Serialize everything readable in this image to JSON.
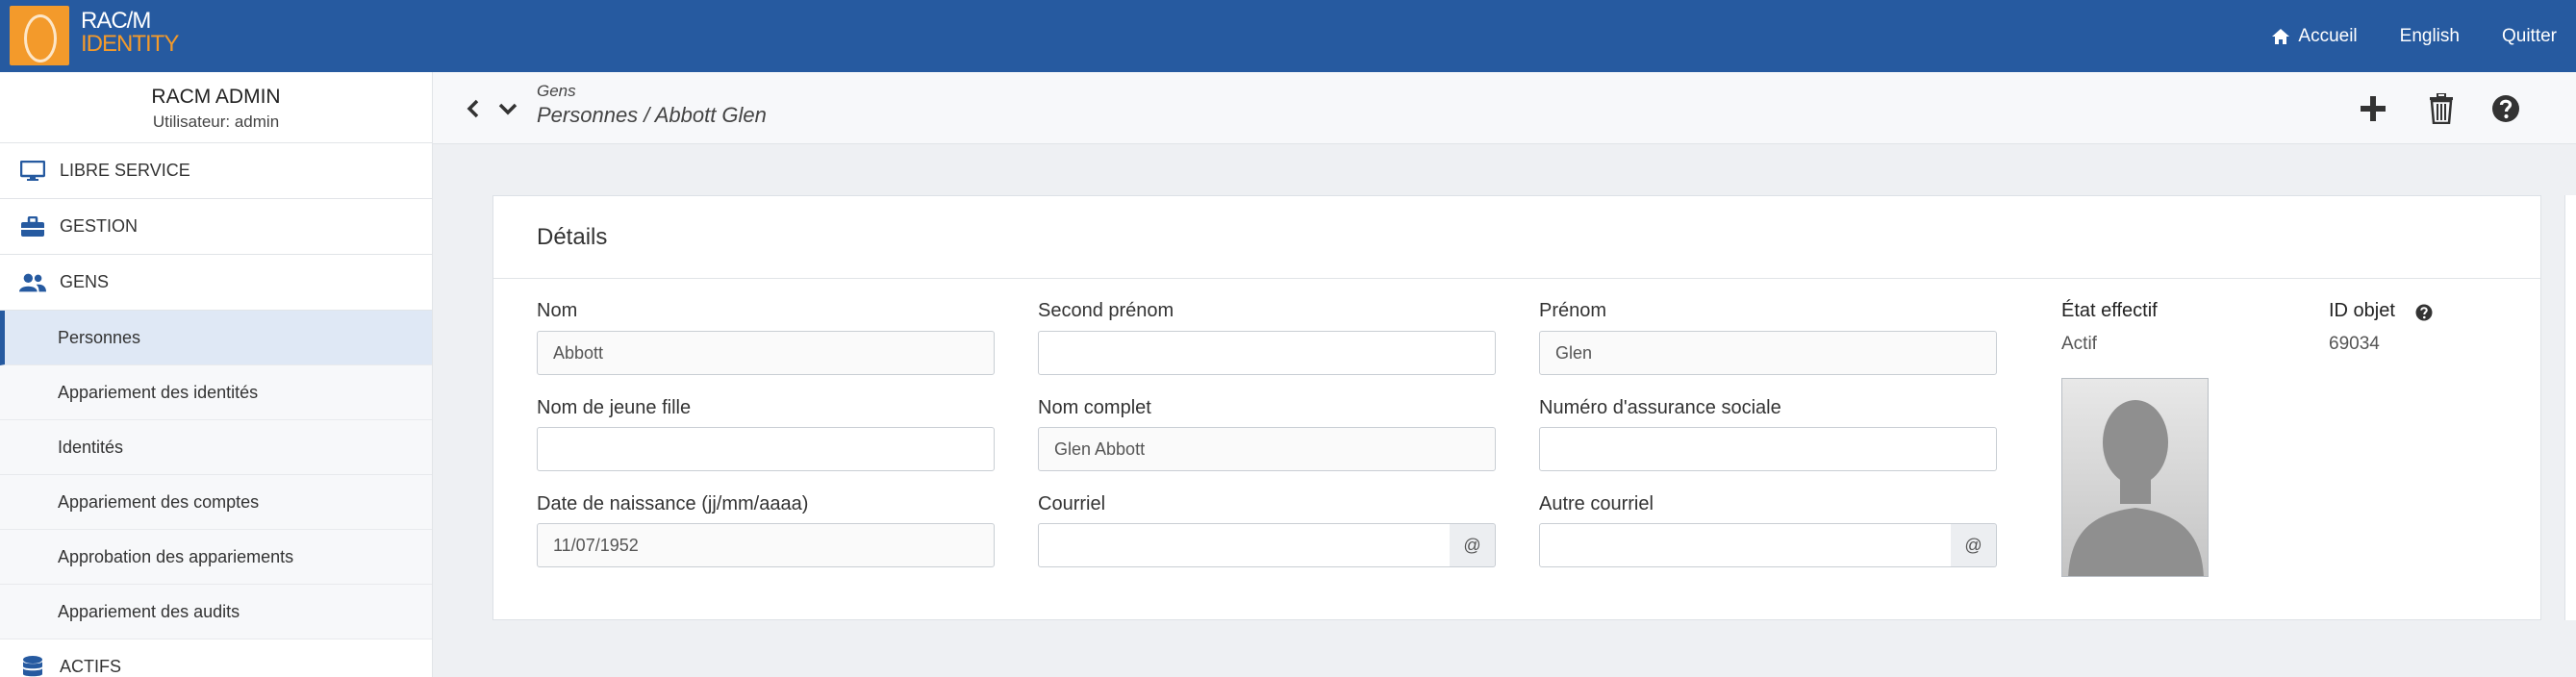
{
  "brand": {
    "line1": "RAC/M",
    "line2": "IDENTITY"
  },
  "topnav": {
    "home": "Accueil",
    "language": "English",
    "quit": "Quitter"
  },
  "user": {
    "name": "RACM ADMIN",
    "role": "Utilisateur: admin"
  },
  "sidebar": {
    "sections": [
      {
        "label": "LIBRE SERVICE",
        "icon": "monitor-icon"
      },
      {
        "label": "GESTION",
        "icon": "toolbox-icon"
      },
      {
        "label": "GENS",
        "icon": "people-icon"
      },
      {
        "label": "ACTIFS",
        "icon": "database-icon"
      }
    ],
    "items": [
      {
        "label": "Personnes",
        "active": true
      },
      {
        "label": "Appariement des identités"
      },
      {
        "label": "Identités"
      },
      {
        "label": "Appariement des comptes"
      },
      {
        "label": "Approbation des appariements"
      },
      {
        "label": "Appariement des audits"
      }
    ]
  },
  "header": {
    "section": "Gens",
    "breadcrumb": "Personnes / Abbott Glen"
  },
  "card": {
    "title": "Détails"
  },
  "form": {
    "nom": {
      "label": "Nom",
      "value": "Abbott"
    },
    "second_prenom": {
      "label": "Second prénom",
      "value": ""
    },
    "prenom": {
      "label": "Prénom",
      "value": "Glen"
    },
    "nom_jeune_fille": {
      "label": "Nom de jeune fille",
      "value": ""
    },
    "nom_complet": {
      "label": "Nom complet",
      "value": "Glen Abbott"
    },
    "nas": {
      "label": "Numéro d'assurance sociale",
      "value": ""
    },
    "date_naissance": {
      "label": "Date de naissance (jj/mm/aaaa)",
      "value": "11/07/1952"
    },
    "courriel": {
      "label": "Courriel",
      "value": "",
      "addon": "@"
    },
    "autre_courriel": {
      "label": "Autre courriel",
      "value": "",
      "addon": "@"
    }
  },
  "info": {
    "etat_label": "État effectif",
    "etat_value": "Actif",
    "id_label": "ID objet",
    "id_value": "69034"
  },
  "colors": {
    "topbar": "#265aa0",
    "accent": "#f39a2b",
    "active_item": "#dfe8f5"
  }
}
